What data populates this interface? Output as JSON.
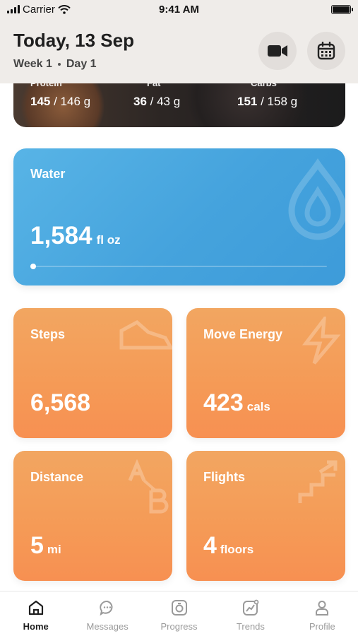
{
  "status_bar": {
    "carrier": "Carrier",
    "time": "9:41 AM"
  },
  "header": {
    "title": "Today, 13 Sep",
    "week": "Week 1",
    "day": "Day 1",
    "video_icon": "video-camera-icon",
    "calendar_icon": "calendar-icon"
  },
  "macros": {
    "protein_label": "Protein",
    "protein_value": "145",
    "protein_target": "/ 146 g",
    "fat_label": "Fat",
    "fat_value": "36",
    "fat_target": "/ 43 g",
    "carbs_label": "Carbs",
    "carbs_value": "151",
    "carbs_target": "/ 158 g"
  },
  "water": {
    "label": "Water",
    "value": "1,584",
    "unit": "fl oz",
    "color": "#4aa9e0"
  },
  "tiles": {
    "steps": {
      "label": "Steps",
      "value": "6,568",
      "unit": ""
    },
    "move": {
      "label": "Move Energy",
      "value": "423",
      "unit": "cals"
    },
    "distance": {
      "label": "Distance",
      "value": "5",
      "unit": "mi"
    },
    "flights": {
      "label": "Flights",
      "value": "4",
      "unit": "floors"
    },
    "color": "#f59a56"
  },
  "tabbar": {
    "items": [
      {
        "label": "Home",
        "icon": "home-icon",
        "active": true
      },
      {
        "label": "Messages",
        "icon": "chat-icon",
        "active": false
      },
      {
        "label": "Progress",
        "icon": "progress-icon",
        "active": false
      },
      {
        "label": "Trends",
        "icon": "trends-icon",
        "active": false
      },
      {
        "label": "Profile",
        "icon": "profile-icon",
        "active": false
      }
    ]
  }
}
